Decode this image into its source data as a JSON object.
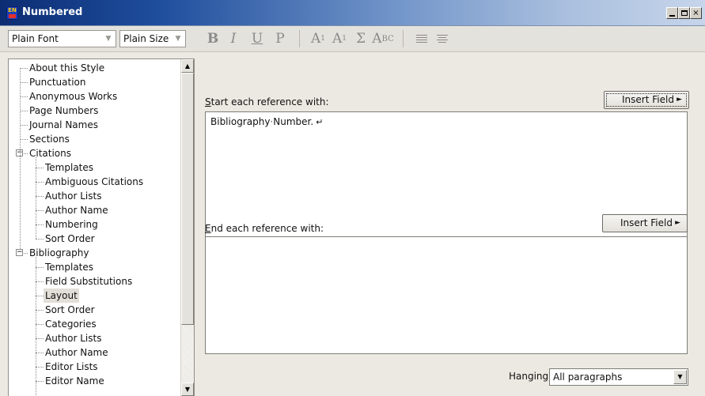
{
  "window": {
    "title": "Numbered",
    "app_icon_text": "EN",
    "buttons": [
      "minimize",
      "maximize",
      "close"
    ],
    "close_glyph": "×"
  },
  "toolbar": {
    "font_combo": "Plain Font",
    "size_combo": "Plain Size",
    "combo_arrow": "▼",
    "bold": "B",
    "italic": "I",
    "underline": "U",
    "plain": "P",
    "superscript_base": "A",
    "superscript_mark": "1",
    "subscript_base": "A",
    "subscript_mark": "1",
    "symbol": "Σ",
    "smallcaps_big": "A",
    "smallcaps_small": "BC",
    "align_icons": [
      "align-left-icon",
      "align-center-icon"
    ]
  },
  "tree": {
    "items": [
      {
        "label": "About this Style",
        "level": 0
      },
      {
        "label": "Punctuation",
        "level": 0
      },
      {
        "label": "Anonymous Works",
        "level": 0
      },
      {
        "label": "Page Numbers",
        "level": 0
      },
      {
        "label": "Journal Names",
        "level": 0
      },
      {
        "label": "Sections",
        "level": 0
      },
      {
        "label": "Citations",
        "level": 0,
        "expander": "−"
      },
      {
        "label": "Templates",
        "level": 1
      },
      {
        "label": "Ambiguous Citations",
        "level": 1
      },
      {
        "label": "Author Lists",
        "level": 1
      },
      {
        "label": "Author Name",
        "level": 1
      },
      {
        "label": "Numbering",
        "level": 1
      },
      {
        "label": "Sort Order",
        "level": 1
      },
      {
        "label": "Bibliography",
        "level": 0,
        "expander": "−"
      },
      {
        "label": "Templates",
        "level": 1
      },
      {
        "label": "Field Substitutions",
        "level": 1
      },
      {
        "label": "Layout",
        "level": 1,
        "selected": true
      },
      {
        "label": "Sort Order",
        "level": 1
      },
      {
        "label": "Categories",
        "level": 1
      },
      {
        "label": "Author Lists",
        "level": 1
      },
      {
        "label": "Author Name",
        "level": 1
      },
      {
        "label": "Editor Lists",
        "level": 1
      },
      {
        "label": "Editor Name",
        "level": 1
      }
    ],
    "scroll_up": "▲",
    "scroll_down": "▼"
  },
  "layout": {
    "start_label_prefix": "S",
    "start_label_rest": "tart each reference with:",
    "start_insert": "Insert Field",
    "start_text_a": "Bibliography",
    "start_text_dot": "·",
    "start_text_b": "Number.",
    "return_mark": "↵",
    "end_label_prefix": "E",
    "end_label_rest": "nd each reference with:",
    "end_insert": "Insert Field",
    "insert_arrow": "►",
    "hanging_label": "Hanging Indent:",
    "hanging_value": "All paragraphs",
    "select_arrow": "▼"
  }
}
